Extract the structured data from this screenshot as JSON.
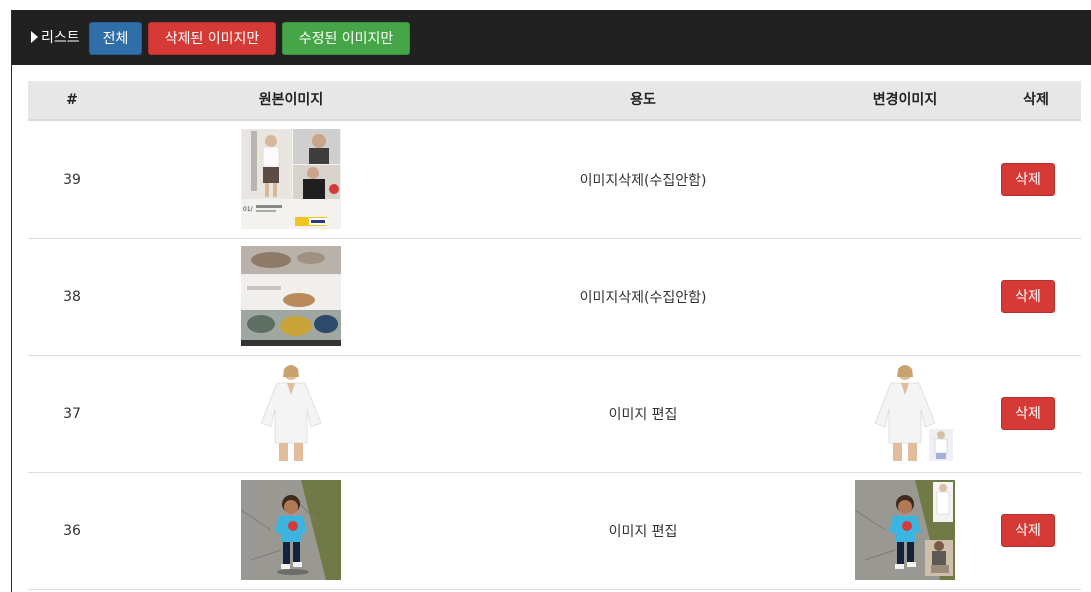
{
  "header": {
    "title": "리스트",
    "filters": {
      "all": "전체",
      "deleted_only": "삭제된 이미지만",
      "edited_only": "수정된 이미지만"
    }
  },
  "table": {
    "columns": {
      "num": "#",
      "original": "원본이미지",
      "usage": "용도",
      "changed": "변경이미지",
      "delete": "삭제"
    },
    "rows": [
      {
        "num": "39",
        "usage": "이미지삭제(수집안함)",
        "delete_label": "삭제"
      },
      {
        "num": "38",
        "usage": "이미지삭제(수집안함)",
        "delete_label": "삭제"
      },
      {
        "num": "37",
        "usage": "이미지 편집",
        "delete_label": "삭제"
      },
      {
        "num": "36",
        "usage": "이미지 편집",
        "delete_label": "삭제"
      }
    ]
  },
  "colors": {
    "header_bg": "#212121",
    "primary": "#2f6ea8",
    "danger": "#d53a36",
    "success": "#46a647"
  }
}
